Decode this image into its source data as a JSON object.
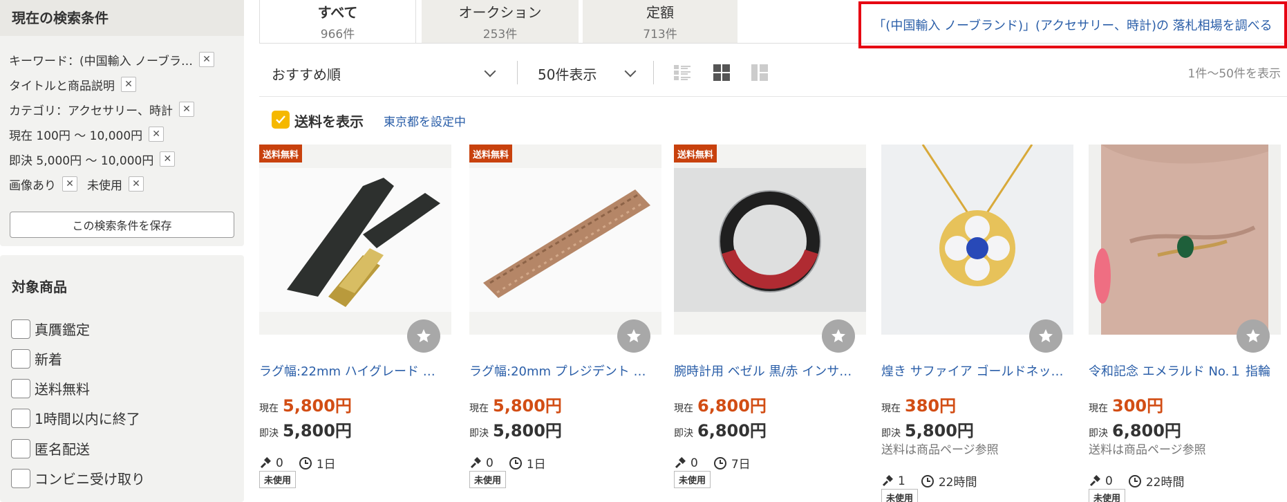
{
  "sidebar": {
    "conditions_title": "現在の検索条件",
    "conditions": [
      {
        "label": "キーワード：(中国輸入 ノーブラ…"
      },
      {
        "label": "タイトルと商品説明"
      },
      {
        "label": "カテゴリ：アクセサリー、時計"
      },
      {
        "label": "現在 100円 ～ 10,000円"
      },
      {
        "label": "即決 5,000円 ～ 10,000円"
      },
      {
        "label": "画像あり",
        "label2": "未使用"
      }
    ],
    "save_button": "この検索条件を保存",
    "target_title": "対象商品",
    "targets": [
      "真贋鑑定",
      "新着",
      "送料無料",
      "1時間以内に終了",
      "匿名配送",
      "コンビニ受け取り"
    ]
  },
  "tabs": [
    {
      "label": "すべて",
      "count": "966件"
    },
    {
      "label": "オークション",
      "count": "253件"
    },
    {
      "label": "定額",
      "count": "713件"
    }
  ],
  "market_link": "「(中国輸入 ノーブランド)」(アクセサリー、時計)の 落札相場を調べる",
  "controls": {
    "sort": "おすすめ順",
    "per_page": "50件表示",
    "result_range": "1件～50件を表示"
  },
  "shipping": {
    "label": "送料を表示",
    "area": "東京都を設定中"
  },
  "labels": {
    "now": "現在",
    "buy": "即決",
    "free_ship": "送料無料"
  },
  "items": [
    {
      "title": "ラグ幅:22mm ハイグレード …",
      "now_price": "5,800円",
      "buy_price": "5,800円",
      "bids": "0",
      "time": "1日",
      "condition": "未使用",
      "ship_note": ""
    },
    {
      "title": "ラグ幅:20mm プレジデント …",
      "now_price": "5,800円",
      "buy_price": "5,800円",
      "bids": "0",
      "time": "1日",
      "condition": "未使用",
      "ship_note": ""
    },
    {
      "title": "腕時計用 ベゼル 黒/赤 インサ…",
      "now_price": "6,800円",
      "buy_price": "6,800円",
      "bids": "0",
      "time": "7日",
      "condition": "未使用",
      "ship_note": ""
    },
    {
      "title": "煌き サファイア ゴールドネッ…",
      "now_price": "380円",
      "buy_price": "5,800円",
      "bids": "1",
      "time": "22時間",
      "condition": "未使用",
      "ship_note": "送料は商品ページ参照"
    },
    {
      "title": "令和記念 エメラルド No.１ 指輪",
      "now_price": "300円",
      "buy_price": "6,800円",
      "bids": "0",
      "time": "22時間",
      "condition": "未使用",
      "ship_note": "送料は商品ページ参照"
    }
  ],
  "colors": {
    "accent_red": "#e60012",
    "price_orange": "#d24d14",
    "link_blue": "#2a5ea8",
    "check_yellow": "#f5b800"
  }
}
